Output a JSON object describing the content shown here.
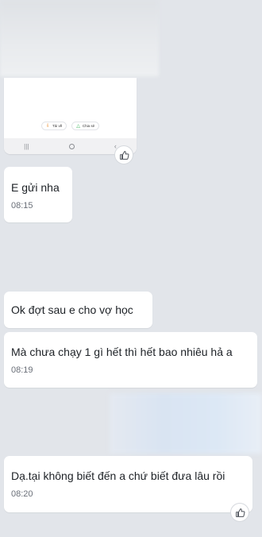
{
  "attachment": {
    "download_label": "Tải về",
    "share_label": "Chia sẻ"
  },
  "messages": [
    {
      "text": "E gửi nha",
      "time": "08:15"
    },
    {
      "text": "Ok đợt sau e cho vợ học",
      "time": ""
    },
    {
      "text": "Mà chưa chạy 1 gì hết thì hết bao nhiêu hả a",
      "time": "08:19"
    },
    {
      "text": "Dạ.tại không biết đến a chứ biết đưa lâu rồi",
      "time": "08:20"
    }
  ],
  "icons": {
    "like": "thumbs-up-icon",
    "download": "download-icon",
    "share": "share-icon"
  },
  "colors": {
    "background": "#e2e5ea",
    "bubble": "#ffffff",
    "text": "#1d2126",
    "time": "#6b7079"
  }
}
